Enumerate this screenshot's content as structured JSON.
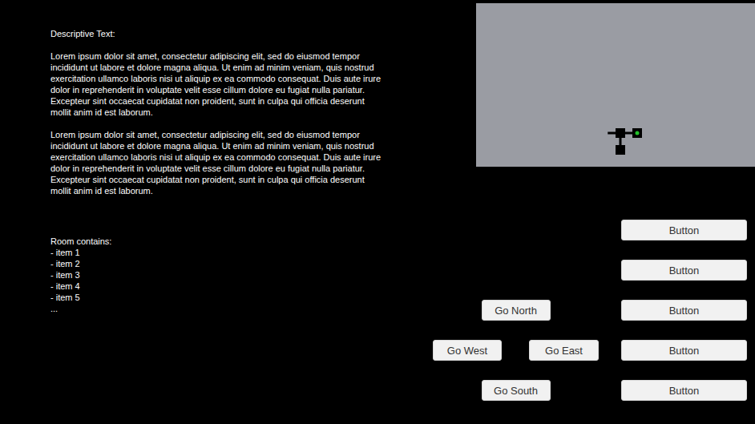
{
  "header": "Descriptive Text:",
  "paragraphs": [
    "Lorem ipsum dolor sit amet, consectetur adipiscing elit, sed do eiusmod tempor incididunt ut labore et dolore magna aliqua. Ut enim ad minim veniam, quis nostrud exercitation ullamco laboris nisi ut aliquip ex ea commodo consequat. Duis aute irure dolor in reprehenderit in voluptate velit esse cillum dolore eu fugiat nulla pariatur. Excepteur sint occaecat cupidatat non proident, sunt in culpa qui officia deserunt mollit anim id est laborum.",
    "Lorem ipsum dolor sit amet, consectetur adipiscing elit, sed do eiusmod tempor incididunt ut labore et dolore magna aliqua. Ut enim ad minim veniam, quis nostrud exercitation ullamco laboris nisi ut aliquip ex ea commodo consequat. Duis aute irure dolor in reprehenderit in voluptate velit esse cillum dolore eu fugiat nulla pariatur. Excepteur sint occaecat cupidatat non proident, sunt in culpa qui officia deserunt mollit anim id est laborum."
  ],
  "inventory": {
    "label": "Room contains:",
    "items": [
      "- item 1",
      "- item 2",
      "- item 3",
      "- item 4",
      "- item 5",
      "..."
    ]
  },
  "map": {
    "rooms": [
      {
        "col": 0,
        "row": 0,
        "current": false
      },
      {
        "col": 1,
        "row": 0,
        "current": true
      },
      {
        "col": 0,
        "row": 1,
        "current": false
      }
    ],
    "corridors": [
      {
        "from": [
          0,
          0
        ],
        "to": [
          -0.75,
          0
        ]
      },
      {
        "from": [
          0,
          0
        ],
        "to": [
          1,
          0
        ]
      },
      {
        "from": [
          0,
          0
        ],
        "to": [
          0,
          1
        ]
      }
    ]
  },
  "navigation": {
    "north": "Go North",
    "west": "Go West",
    "east": "Go East",
    "south": "Go South"
  },
  "actions": [
    "Button",
    "Button",
    "Button",
    "Button",
    "Button"
  ]
}
